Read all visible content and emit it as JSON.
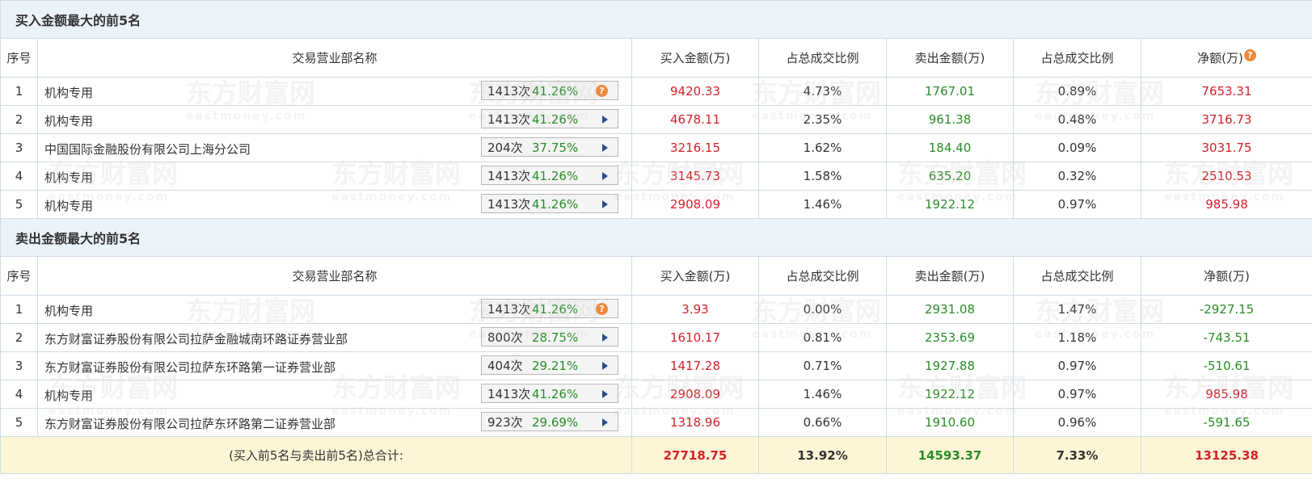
{
  "buy_section": {
    "title": "买入金额最大的前5名",
    "headers": [
      "序号",
      "交易营业部名称",
      "买入金额(万)",
      "占总成交比例",
      "卖出金额(万)",
      "占总成交比例",
      "净额(万)"
    ],
    "rows": [
      {
        "idx": "1",
        "name": "机构专用",
        "count": "1413次",
        "pct": "41.26%",
        "icon": "question-icon",
        "buy": "9420.33",
        "buy_pct": "4.73%",
        "sell": "1767.01",
        "sell_pct": "0.89%",
        "net": "7653.31"
      },
      {
        "idx": "2",
        "name": "机构专用",
        "count": "1413次",
        "pct": "41.26%",
        "icon": "expand-arrow-icon",
        "buy": "4678.11",
        "buy_pct": "2.35%",
        "sell": "961.38",
        "sell_pct": "0.48%",
        "net": "3716.73"
      },
      {
        "idx": "3",
        "name": "中国国际金融股份有限公司上海分公司",
        "count": "204次",
        "pct": "37.75%",
        "icon": "expand-arrow-icon",
        "buy": "3216.15",
        "buy_pct": "1.62%",
        "sell": "184.40",
        "sell_pct": "0.09%",
        "net": "3031.75"
      },
      {
        "idx": "4",
        "name": "机构专用",
        "count": "1413次",
        "pct": "41.26%",
        "icon": "expand-arrow-icon",
        "buy": "3145.73",
        "buy_pct": "1.58%",
        "sell": "635.20",
        "sell_pct": "0.32%",
        "net": "2510.53"
      },
      {
        "idx": "5",
        "name": "机构专用",
        "count": "1413次",
        "pct": "41.26%",
        "icon": "expand-arrow-icon",
        "buy": "2908.09",
        "buy_pct": "1.46%",
        "sell": "1922.12",
        "sell_pct": "0.97%",
        "net": "985.98"
      }
    ]
  },
  "sell_section": {
    "title": "卖出金额最大的前5名",
    "headers": [
      "序号",
      "交易营业部名称",
      "买入金额(万)",
      "占总成交比例",
      "卖出金额(万)",
      "占总成交比例",
      "净额(万)"
    ],
    "rows": [
      {
        "idx": "1",
        "name": "机构专用",
        "count": "1413次",
        "pct": "41.26%",
        "icon": "question-icon",
        "buy": "3.93",
        "buy_pct": "0.00%",
        "sell": "2931.08",
        "sell_pct": "1.47%",
        "net": "-2927.15"
      },
      {
        "idx": "2",
        "name": "东方财富证券股份有限公司拉萨金融城南环路证券营业部",
        "count": "800次",
        "pct": "28.75%",
        "icon": "expand-arrow-icon",
        "buy": "1610.17",
        "buy_pct": "0.81%",
        "sell": "2353.69",
        "sell_pct": "1.18%",
        "net": "-743.51"
      },
      {
        "idx": "3",
        "name": "东方财富证券股份有限公司拉萨东环路第一证券营业部",
        "count": "404次",
        "pct": "29.21%",
        "icon": "expand-arrow-icon",
        "buy": "1417.28",
        "buy_pct": "0.71%",
        "sell": "1927.88",
        "sell_pct": "0.97%",
        "net": "-510.61"
      },
      {
        "idx": "4",
        "name": "机构专用",
        "count": "1413次",
        "pct": "41.26%",
        "icon": "expand-arrow-icon",
        "buy": "2908.09",
        "buy_pct": "1.46%",
        "sell": "1922.12",
        "sell_pct": "0.97%",
        "net": "985.98"
      },
      {
        "idx": "5",
        "name": "东方财富证券股份有限公司拉萨东环路第二证券营业部",
        "count": "923次",
        "pct": "29.69%",
        "icon": "expand-arrow-icon",
        "buy": "1318.96",
        "buy_pct": "0.66%",
        "sell": "1910.60",
        "sell_pct": "0.96%",
        "net": "-591.65"
      }
    ]
  },
  "total": {
    "label": "(买入前5名与卖出前5名)总合计:",
    "buy": "27718.75",
    "buy_pct": "13.92%",
    "sell": "14593.37",
    "sell_pct": "7.33%",
    "net": "13125.38"
  },
  "watermark": {
    "brand": "东方财富网",
    "url": "eastmoney.com"
  },
  "colors": {
    "positive": "#d6212a",
    "negative": "#2a8c2a",
    "header_bg": "#eaf2fa",
    "total_bg": "#fdf6d6",
    "border": "#cfdbe6",
    "question_icon": "#f08a3c",
    "arrow": "#2b4d8c"
  }
}
